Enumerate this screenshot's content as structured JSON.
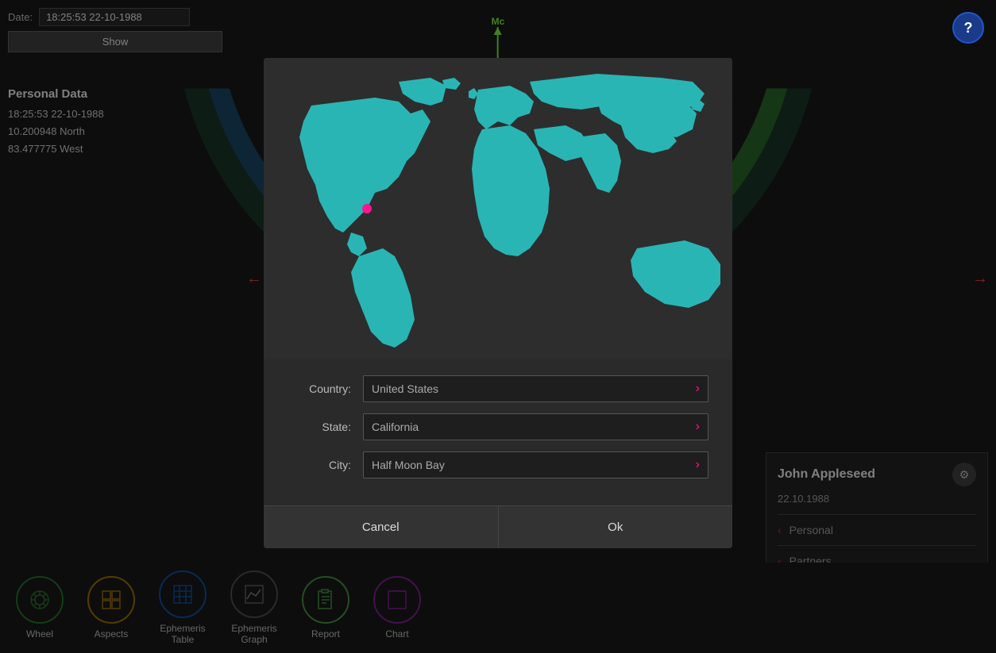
{
  "header": {
    "date_label": "Date:",
    "date_value": "18:25:53 22-10-1988",
    "show_button": "Show",
    "help_button": "?"
  },
  "personal_data": {
    "title": "Personal Data",
    "datetime": "18:25:53 22-10-1988",
    "latitude": "10.200948 North",
    "longitude": "83.477775 West"
  },
  "mc": {
    "label": "Mc"
  },
  "modal": {
    "country_label": "Country:",
    "country_value": "United States",
    "state_label": "State:",
    "state_value": "California",
    "city_label": "City:",
    "city_value": "Half Moon Bay",
    "cancel_btn": "Cancel",
    "ok_btn": "Ok"
  },
  "bottom_nav": {
    "items": [
      {
        "id": "wheel",
        "label": "Wheel",
        "icon": "⚙"
      },
      {
        "id": "aspects",
        "label": "Aspects",
        "icon": "▦"
      },
      {
        "id": "ephemeris-table",
        "label": "Ephemeris\nTable",
        "icon": "⊞"
      },
      {
        "id": "ephemeris-graph",
        "label": "Ephemeris\nGraph",
        "icon": "⬚"
      },
      {
        "id": "report",
        "label": "Report",
        "icon": "❐"
      },
      {
        "id": "chart",
        "label": "Chart",
        "icon": "▭"
      }
    ]
  },
  "profile": {
    "name": "John Appleseed",
    "date": "22.10.1988",
    "personal_label": "Personal",
    "partners_label": "Partners"
  }
}
